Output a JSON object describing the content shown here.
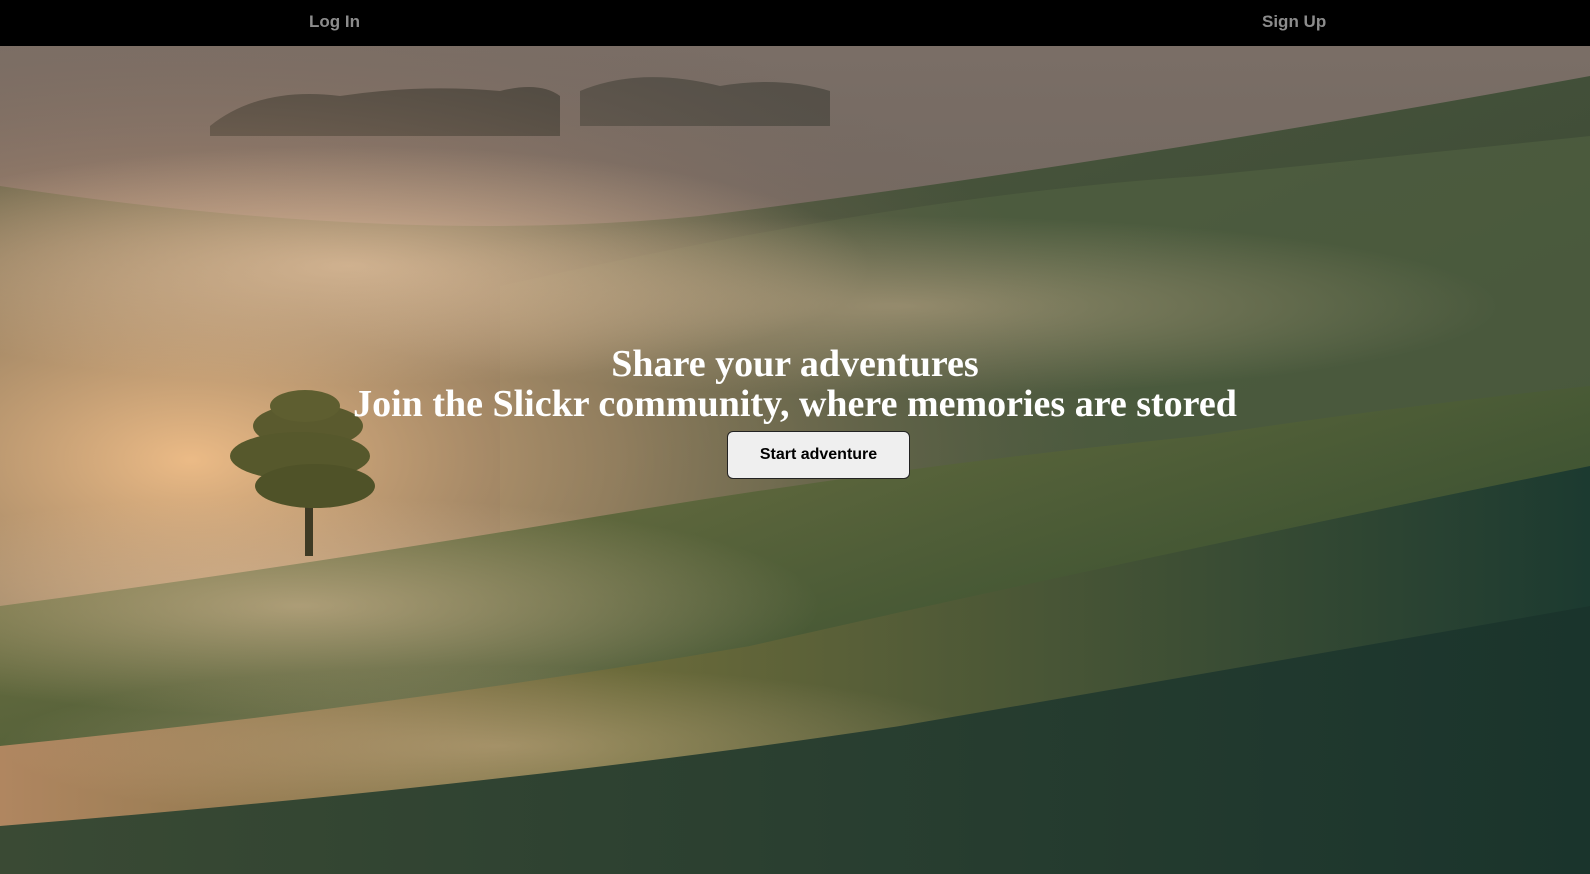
{
  "nav": {
    "login_label": "Log In",
    "signup_label": "Sign Up"
  },
  "hero": {
    "headline_line1": "Share your adventures",
    "headline_line2": "Join the Slickr community, where memories are stored",
    "cta_label": "Start adventure"
  },
  "colors": {
    "topbar_bg": "#000000",
    "nav_link": "#8c8c8c",
    "headline": "#ffffff",
    "cta_bg": "#efefef"
  }
}
